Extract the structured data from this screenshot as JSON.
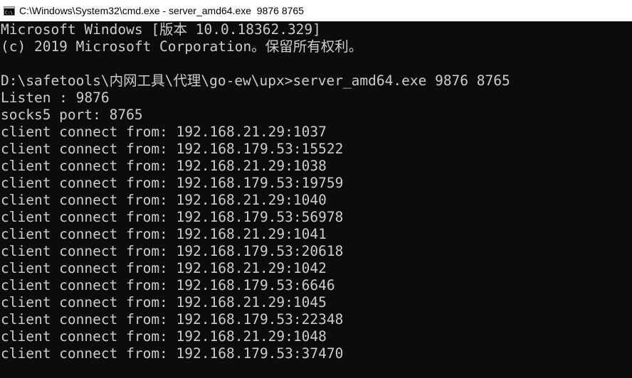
{
  "window": {
    "title": "C:\\Windows\\System32\\cmd.exe - server_amd64.exe  9876 8765",
    "icon": "cmd-icon",
    "colors": {
      "titlebar_bg": "#ffffff",
      "console_bg": "#0c0c0c",
      "console_text": "#cccccc"
    }
  },
  "console": {
    "lines": [
      "Microsoft Windows [版本 10.0.18362.329]",
      "(c) 2019 Microsoft Corporation。保留所有权利。",
      "",
      "D:\\safetools\\内网工具\\代理\\go-ew\\upx>server_amd64.exe 9876 8765",
      "Listen : 9876",
      "socks5 port: 8765",
      "client connect from: 192.168.21.29:1037",
      "client connect from: 192.168.179.53:15522",
      "client connect from: 192.168.21.29:1038",
      "client connect from: 192.168.179.53:19759",
      "client connect from: 192.168.21.29:1040",
      "client connect from: 192.168.179.53:56978",
      "client connect from: 192.168.21.29:1041",
      "client connect from: 192.168.179.53:20618",
      "client connect from: 192.168.21.29:1042",
      "client connect from: 192.168.179.53:6646",
      "client connect from: 192.168.21.29:1045",
      "client connect from: 192.168.179.53:22348",
      "client connect from: 192.168.21.29:1048",
      "client connect from: 192.168.179.53:37470"
    ]
  }
}
